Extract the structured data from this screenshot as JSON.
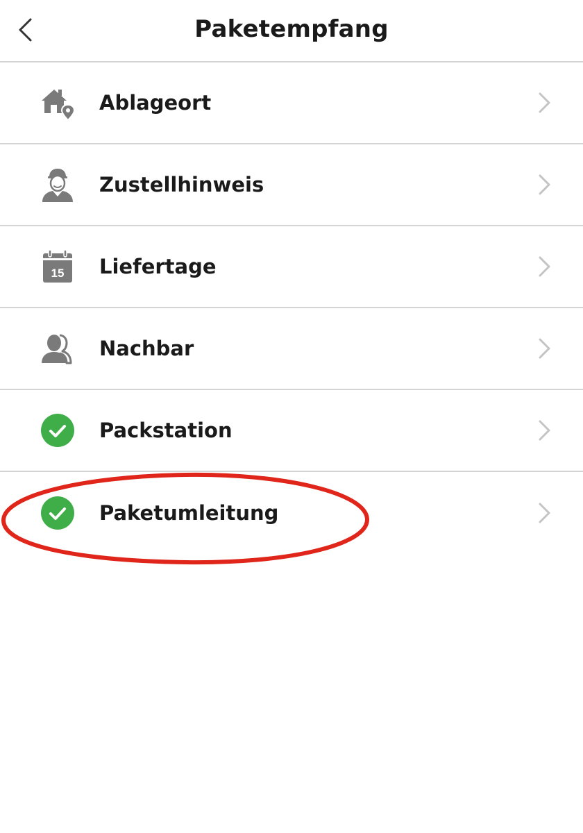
{
  "header": {
    "title": "Paketempfang",
    "back_icon": "chevron-left-icon"
  },
  "menu": {
    "items": [
      {
        "label": "Ablageort",
        "icon": "house-location-icon",
        "icon_color": "#7a7a7a"
      },
      {
        "label": "Zustellhinweis",
        "icon": "delivery-person-icon",
        "icon_color": "#7a7a7a"
      },
      {
        "label": "Liefertage",
        "icon": "calendar-icon",
        "icon_text": "15",
        "icon_color": "#7a7a7a"
      },
      {
        "label": "Nachbar",
        "icon": "neighbors-icon",
        "icon_color": "#7a7a7a"
      },
      {
        "label": "Packstation",
        "icon": "check-circle-icon",
        "icon_color": "#3fae49",
        "status": "active"
      },
      {
        "label": "Paketumleitung",
        "icon": "check-circle-icon",
        "icon_color": "#3fae49",
        "status": "active"
      }
    ],
    "chevron_icon": "chevron-right-icon",
    "chevron_color": "#c4c4c4"
  },
  "annotation": {
    "type": "highlight-ellipse",
    "color": "#e0261b",
    "target": "Paketumleitung"
  }
}
